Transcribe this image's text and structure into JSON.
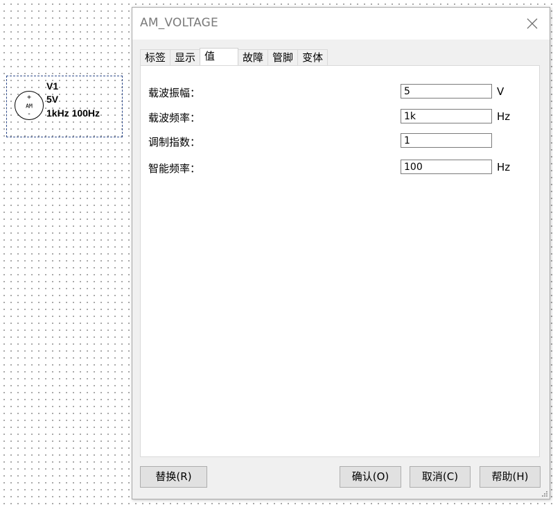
{
  "schematic": {
    "symbol_text": "AM",
    "plus_sign": "+",
    "minus_sign": "-",
    "ref": "V1",
    "amplitude": "5V",
    "frequencies": "1kHz 100Hz"
  },
  "dialog": {
    "title": "AM_VOLTAGE",
    "tabs": [
      {
        "label": "标签"
      },
      {
        "label": "显示"
      },
      {
        "label": "值"
      },
      {
        "label": "故障"
      },
      {
        "label": "管脚"
      },
      {
        "label": "变体"
      }
    ],
    "active_tab": "值",
    "params": [
      {
        "label": "载波振幅：",
        "value": "5",
        "unit": "V"
      },
      {
        "label": "载波频率：",
        "value": "1k",
        "unit": "Hz"
      },
      {
        "label": "调制指数：",
        "value": "1",
        "unit": ""
      },
      {
        "label": "智能频率：",
        "value": "100",
        "unit": "Hz"
      }
    ],
    "buttons": {
      "replace": "替换(R)",
      "ok": "确认(O)",
      "cancel": "取消(C)",
      "help": "帮助(H)"
    }
  },
  "icons": {
    "close": "close-icon",
    "resize": "resize-grip-icon"
  }
}
